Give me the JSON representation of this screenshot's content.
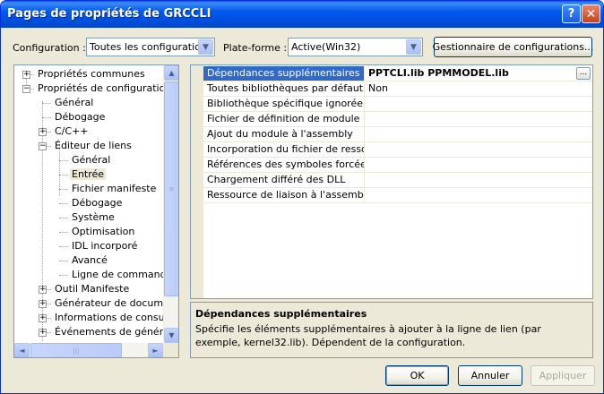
{
  "window": {
    "title": "Pages de propriétés de GRCCLI",
    "help_glyph": "?",
    "close_glyph": "✕"
  },
  "toolbar": {
    "configuration_label": "Configuration :",
    "configuration_value": "Toutes les configurations",
    "platform_label": "Plate-forme :",
    "platform_value": "Active(Win32)",
    "config_manager_button": "Gestionnaire de configurations..."
  },
  "tree": {
    "items": [
      {
        "label": "Propriétés communes",
        "expander": "+"
      },
      {
        "label": "Propriétés de configuration",
        "expander": "−"
      },
      {
        "label": "Général"
      },
      {
        "label": "Débogage"
      },
      {
        "label": "C/C++",
        "expander": "+"
      },
      {
        "label": "Éditeur de liens",
        "expander": "−"
      },
      {
        "label": "Général"
      },
      {
        "label": "Entrée",
        "selected": true
      },
      {
        "label": "Fichier manifeste"
      },
      {
        "label": "Débogage"
      },
      {
        "label": "Système"
      },
      {
        "label": "Optimisation"
      },
      {
        "label": "IDL incorporé"
      },
      {
        "label": "Avancé"
      },
      {
        "label": "Ligne de commande"
      },
      {
        "label": "Outil Manifeste",
        "expander": "+"
      },
      {
        "label": "Générateur de document",
        "expander": "+"
      },
      {
        "label": "Informations de consultat",
        "expander": "+"
      },
      {
        "label": "Événements de génératio",
        "expander": "+"
      }
    ]
  },
  "grid": {
    "rows": [
      {
        "name": "Dépendances supplémentaires",
        "value": "PPTCLI.lib PPMMODEL.lib",
        "selected": true
      },
      {
        "name": "Toutes bibliothèques par défaut igno",
        "value": "Non"
      },
      {
        "name": "Bibliothèque spécifique ignorée",
        "value": ""
      },
      {
        "name": "Fichier de définition de module",
        "value": ""
      },
      {
        "name": "Ajout du module à l'assembly",
        "value": ""
      },
      {
        "name": "Incorporation du fichier de ressource",
        "value": ""
      },
      {
        "name": "Références des symboles forcées",
        "value": ""
      },
      {
        "name": "Chargement différé des DLL",
        "value": ""
      },
      {
        "name": "Ressource de liaison à l'assembly",
        "value": ""
      }
    ],
    "ellipsis_label": "..."
  },
  "description": {
    "title": "Dépendances supplémentaires",
    "text": "Spécifie les éléments supplémentaires à ajouter à la ligne de lien (par exemple, kernel32.lib). Dépendent de la configuration."
  },
  "buttons": {
    "ok": "OK",
    "cancel": "Annuler",
    "apply": "Appliquer"
  }
}
